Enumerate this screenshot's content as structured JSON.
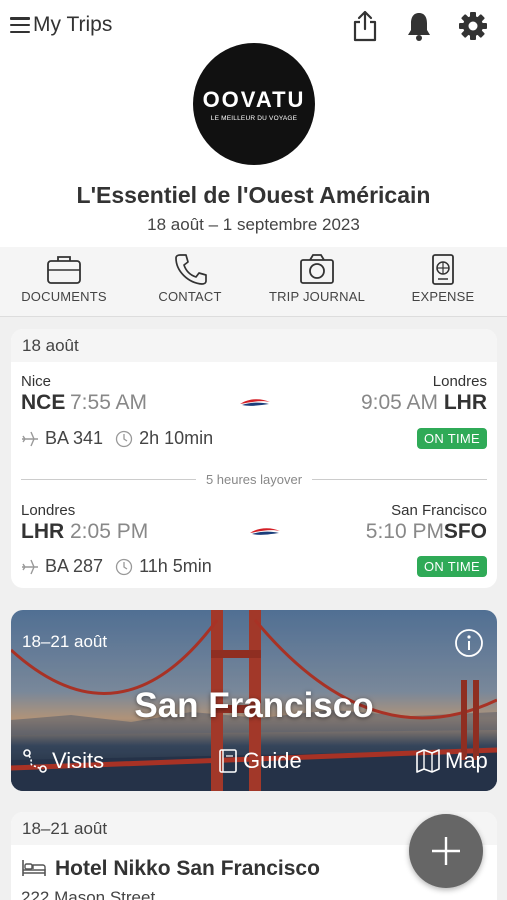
{
  "app": {
    "title": "My Trips"
  },
  "header": {
    "logo_brand": "OOVATU",
    "logo_tagline": "LE MEILLEUR DU VOYAGE",
    "trip_title": "L'Essentiel de l'Ouest Américain",
    "trip_dates": "18 août – 1 septembre 2023"
  },
  "quicknav": [
    {
      "label": "DOCUMENTS",
      "icon": "briefcase-icon"
    },
    {
      "label": "CONTACT",
      "icon": "phone-icon"
    },
    {
      "label": "TRIP JOURNAL",
      "icon": "camera-icon"
    },
    {
      "label": "EXPENSE",
      "icon": "passport-icon"
    }
  ],
  "flight_card": {
    "date": "18 août",
    "layover": "5 heures layover",
    "flights": [
      {
        "from_city": "Nice",
        "from_code": "NCE",
        "dep_time": "7:55 AM",
        "to_city": "Londres",
        "to_code": "LHR",
        "arr_time": "9:05 AM",
        "flight_no": "BA 341",
        "duration": "2h 10min",
        "status": "ON TIME"
      },
      {
        "from_city": "Londres",
        "from_code": "LHR",
        "dep_time": "2:05 PM",
        "to_city": "San Francisco",
        "to_code": "SFO",
        "arr_time": "5:10 PM",
        "flight_no": "BA 287",
        "duration": "11h 5min",
        "status": "ON TIME"
      }
    ]
  },
  "city_card": {
    "dates": "18–21 août",
    "name": "San Francisco",
    "actions": {
      "visits": "Visits",
      "guide": "Guide",
      "map": "Map"
    }
  },
  "hotel_card": {
    "dates": "18–21 août",
    "name": "Hotel Nikko San Francisco",
    "address": "222 Mason Street"
  },
  "colors": {
    "on_time": "#2faa57",
    "fab": "#666666",
    "airline_red": "#d42027",
    "airline_blue": "#1b3d7a"
  }
}
